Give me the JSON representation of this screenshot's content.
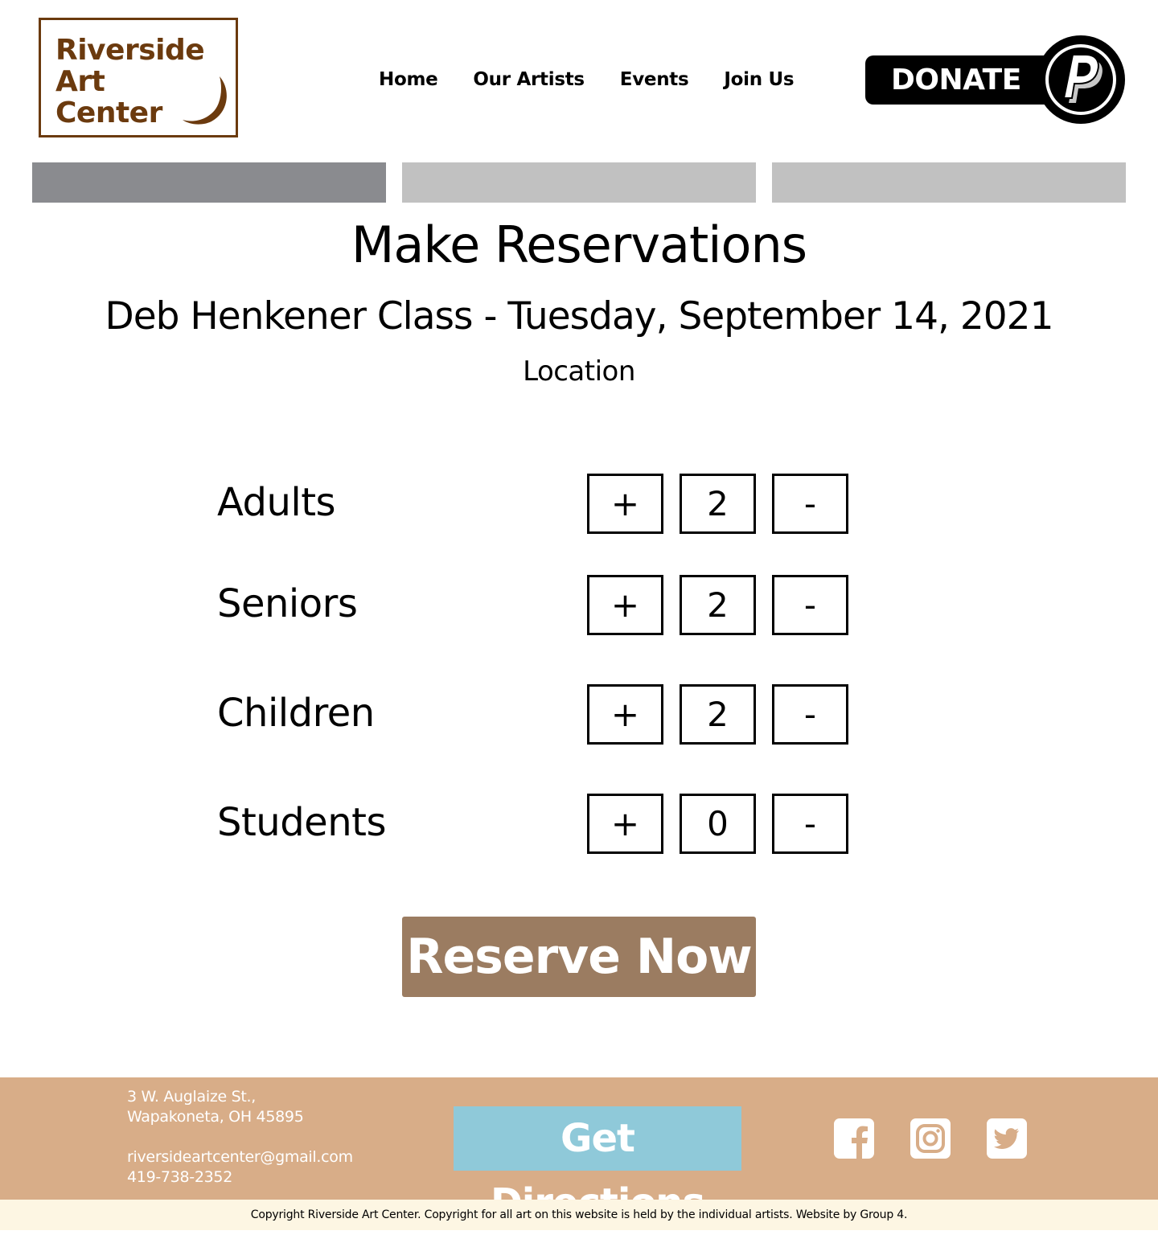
{
  "brand": {
    "logo_line1": "Riverside",
    "logo_line2": "Art",
    "logo_line3": "Center",
    "color": "#6b3a0e"
  },
  "nav": {
    "items": [
      "Home",
      "Our Artists",
      "Events",
      "Join Us"
    ]
  },
  "donate": {
    "label": "DONATE",
    "icon": "paypal-icon"
  },
  "progress": {
    "total_steps": 3,
    "current_step": 1
  },
  "main": {
    "title": "Make Reservations",
    "subtitle": "Deb Henkener Class - Tuesday, September 14, 2021",
    "location": "Location",
    "plus_label": "+",
    "minus_label": "-",
    "tickets": [
      {
        "label": "Adults",
        "count": "2"
      },
      {
        "label": "Seniors",
        "count": "2"
      },
      {
        "label": "Children",
        "count": "2"
      },
      {
        "label": "Students",
        "count": "0"
      }
    ],
    "reserve_label": "Reserve Now",
    "reserve_color": "#9b7c61"
  },
  "footer": {
    "address_line1": "3 W. Auglaize St.,",
    "address_line2": "Wapakoneta, OH 45895",
    "email": "riversideartcenter@gmail.com",
    "phone": "419-738-2352",
    "directions_label": "Get Directions",
    "social_icons": [
      "facebook-icon",
      "instagram-icon",
      "twitter-icon"
    ],
    "background": "#d8ad88",
    "directions_color": "#8fc9d9",
    "copyright": "Copyright Riverside Art Center. Copyright for all art on this website is held by the individual artists. Website by Group 4."
  }
}
